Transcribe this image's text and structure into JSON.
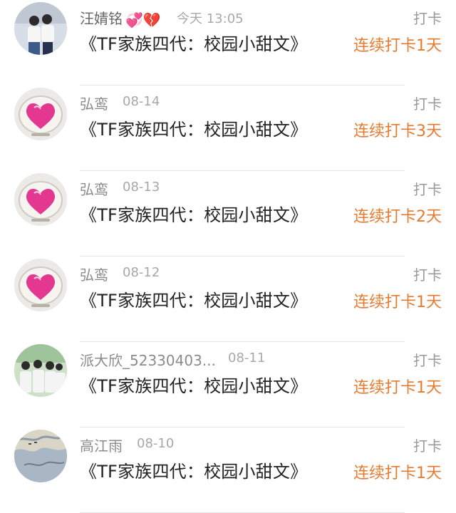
{
  "accent_color": "#e77a2e",
  "items": [
    {
      "name": "汪婧铭",
      "badge": "💞💔",
      "date": "今天 13:05",
      "book": "《TF家族四代：校园小甜文》",
      "action": "打卡",
      "streak": "连续打卡1天",
      "avatar": "couple-photo"
    },
    {
      "name": "弘鸾",
      "date": "08-14",
      "book": "《TF家族四代：校园小甜文》",
      "action": "打卡",
      "streak": "连续打卡3天",
      "avatar": "pink-heart"
    },
    {
      "name": "弘鸾",
      "date": "08-13",
      "book": "《TF家族四代：校园小甜文》",
      "action": "打卡",
      "streak": "连续打卡2天",
      "avatar": "pink-heart"
    },
    {
      "name": "弘鸾",
      "date": "08-12",
      "book": "《TF家族四代：校园小甜文》",
      "action": "打卡",
      "streak": "连续打卡1天",
      "avatar": "pink-heart"
    },
    {
      "name": "派大欣_52330403...",
      "date": "08-11",
      "book": "《TF家族四代：校园小甜文》",
      "action": "打卡",
      "streak": "连续打卡1天",
      "avatar": "group-photo"
    },
    {
      "name": "高江雨",
      "date": "08-10",
      "book": "《TF家族四代：校园小甜文》",
      "action": "打卡",
      "streak": "连续打卡1天",
      "avatar": "map-art"
    }
  ]
}
